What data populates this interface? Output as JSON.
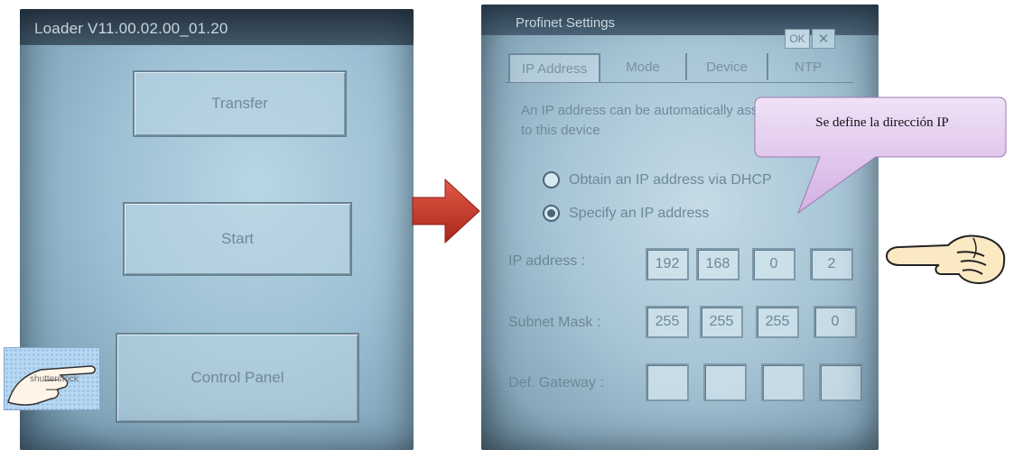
{
  "loader": {
    "title": "Loader V11.00.02.00_01.20",
    "buttons": {
      "transfer": "Transfer",
      "start": "Start",
      "control_panel": "Control Panel"
    },
    "watermark": "shutterstock"
  },
  "profinet": {
    "title": "Profinet Settings",
    "ok_label": "OK",
    "close_glyph": "✕",
    "tabs": [
      {
        "label": "IP Address",
        "active": true
      },
      {
        "label": "Mode",
        "active": false
      },
      {
        "label": "Device",
        "active": false
      },
      {
        "label": "NTP",
        "active": false
      }
    ],
    "description": "An IP address can be automatically assigned to this device",
    "options": {
      "dhcp": {
        "label": "Obtain an IP address via DHCP",
        "selected": false
      },
      "static": {
        "label": "Specify an IP address",
        "selected": true
      }
    },
    "fields": {
      "ip": {
        "label": "IP address :",
        "octets": [
          "192",
          "168",
          "0",
          "2"
        ]
      },
      "mask": {
        "label": "Subnet Mask :",
        "octets": [
          "255",
          "255",
          "255",
          "0"
        ]
      },
      "gateway": {
        "label": "Def. Gateway :",
        "octets": [
          "",
          "",
          "",
          ""
        ]
      }
    }
  },
  "annotation": {
    "callout_text": "Se define la dirección IP",
    "callout_color": "#d9b8e8",
    "arrow_color": "#c0392b",
    "icons": [
      "pointing-hand-icon",
      "red-arrow-icon"
    ]
  }
}
